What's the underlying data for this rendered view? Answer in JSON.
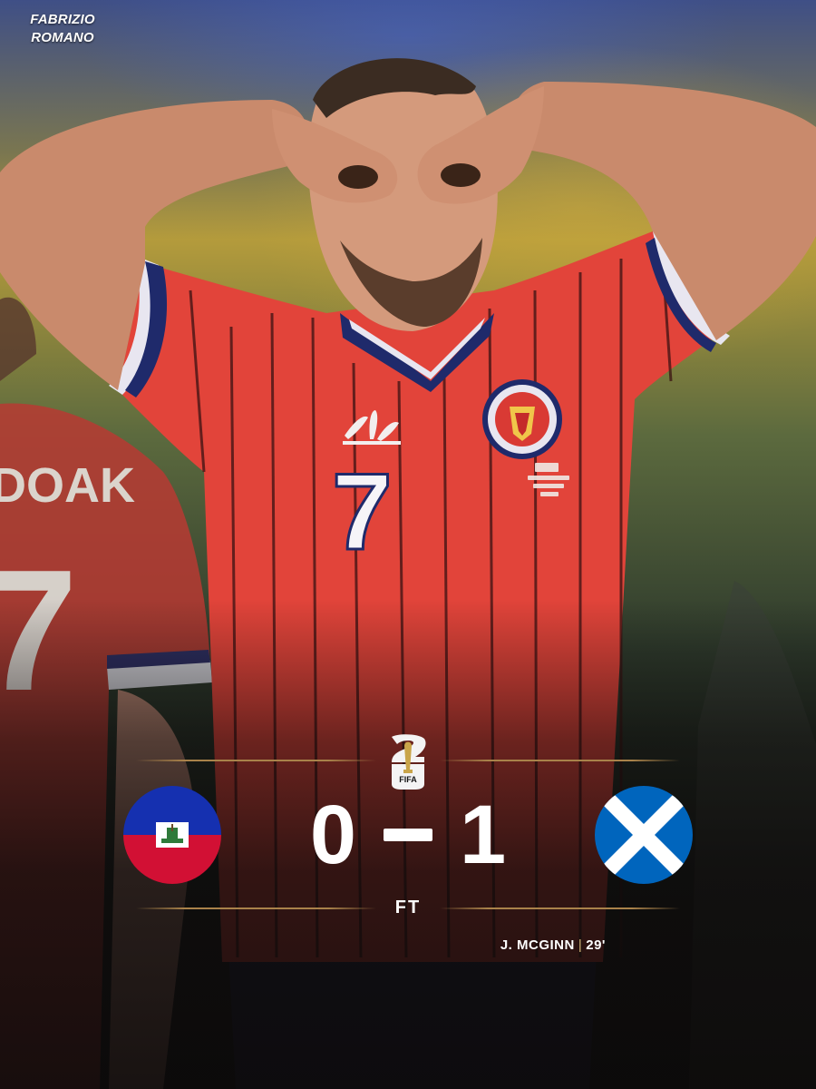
{
  "watermark": {
    "line1": "FABRIZIO",
    "line2": "ROMANO"
  },
  "jersey": {
    "number": "7",
    "name_fragment": "DOAK",
    "back_number": "7"
  },
  "match": {
    "home_goals": "0",
    "away_goals": "1",
    "status": "FT",
    "tournament_mark": "FIFA",
    "home_flag": "haiti-flag",
    "away_flag": "scotland-flag"
  },
  "scorer": {
    "name": "J. MCGINN",
    "separator": "|",
    "minute": "29'"
  },
  "colors": {
    "kit_red": "#e2443a",
    "kit_navy": "#1f2a6b",
    "gold_rule": "#a9824a",
    "haiti_blue": "#1530b0",
    "haiti_red": "#d21034",
    "scotland_blue": "#0065bd"
  }
}
